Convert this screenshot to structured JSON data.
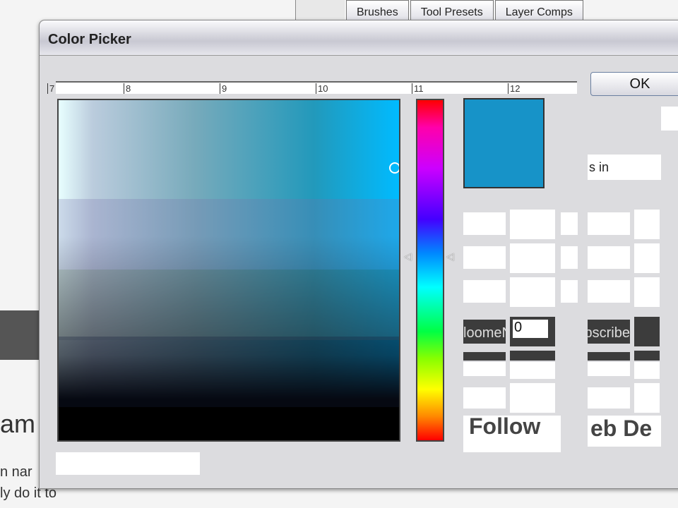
{
  "panel_tabs": [
    "Brushes",
    "Tool Presets",
    "Layer Comps"
  ],
  "dialog": {
    "title": "Color Picker",
    "ok_label": "OK",
    "ruler_labels": [
      "7",
      "8",
      "9",
      "10",
      "11",
      "12"
    ],
    "selected_color": "#1793c8",
    "partial_field_text": "s in",
    "field_value": "0",
    "overlay_texts": [
      "loomeN",
      "ubscribe",
      "Follow",
      "eb De"
    ]
  },
  "background": {
    "heading": "am",
    "lines": [
      "n nar",
      "ly do it to"
    ]
  }
}
